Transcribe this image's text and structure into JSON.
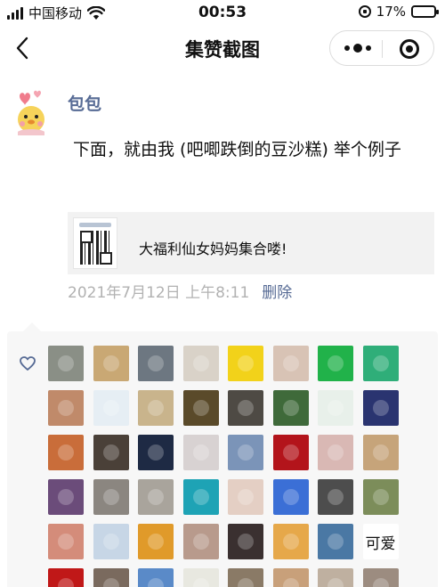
{
  "status_bar": {
    "carrier": "中国移动",
    "time": "00:53",
    "battery": "17%",
    "battery_level": 0.17
  },
  "nav": {
    "title": "集赞截图"
  },
  "post": {
    "author": "包包",
    "content": "下面，就由我 (吧唧跌倒的豆沙糕) 举个例子",
    "share_title": "大福利仙女妈妈集合喽!",
    "timestamp": "2021年7月12日 上午8:11",
    "delete_label": "删除"
  },
  "likes": {
    "avatars": [
      {
        "color": "#8a8f86"
      },
      {
        "color": "#c9a874"
      },
      {
        "color": "#6d7781"
      },
      {
        "color": "#d9d2c8"
      },
      {
        "color": "#f2d21a"
      },
      {
        "color": "#d8c3b5"
      },
      {
        "color": "#21b24a"
      },
      {
        "color": "#2fae79"
      },
      {
        "color": "#c08a6a"
      },
      {
        "color": "#e6eef4"
      },
      {
        "color": "#c9b48c"
      },
      {
        "color": "#5a4a2a"
      },
      {
        "color": "#4e4a44"
      },
      {
        "color": "#3f6a3a"
      },
      {
        "color": "#e8f0ea"
      },
      {
        "color": "#2a3470"
      },
      {
        "color": "#c96d3a"
      },
      {
        "color": "#4a4038"
      },
      {
        "color": "#1e2a44"
      },
      {
        "color": "#d8d2d2"
      },
      {
        "color": "#7b94b8"
      },
      {
        "color": "#b3141b"
      },
      {
        "color": "#d9b8b4"
      },
      {
        "color": "#c6a47a"
      },
      {
        "color": "#6b4c7a"
      },
      {
        "color": "#8b8680"
      },
      {
        "color": "#a9a49c"
      },
      {
        "color": "#1ea3b5"
      },
      {
        "color": "#e4cfc4"
      },
      {
        "color": "#3b6fd6"
      },
      {
        "color": "#4d4d4d"
      },
      {
        "color": "#7c8d5a"
      },
      {
        "color": "#d48c7a"
      },
      {
        "color": "#c7d6e6"
      },
      {
        "color": "#e09a2a"
      },
      {
        "color": "#b89a8c"
      },
      {
        "color": "#3a3030"
      },
      {
        "color": "#e6a84a"
      },
      {
        "color": "#4a78a4"
      },
      {
        "color": "#ffffff",
        "text": "可爱"
      },
      {
        "color": "#c01818"
      },
      {
        "color": "#7a6a5e"
      },
      {
        "color": "#5a8ac8"
      },
      {
        "color": "#e8e8e0"
      },
      {
        "color": "#8a7a66"
      },
      {
        "color": "#c8a07a"
      },
      {
        "color": "#bfb0a0"
      },
      {
        "color": "#9c8c80"
      }
    ]
  }
}
